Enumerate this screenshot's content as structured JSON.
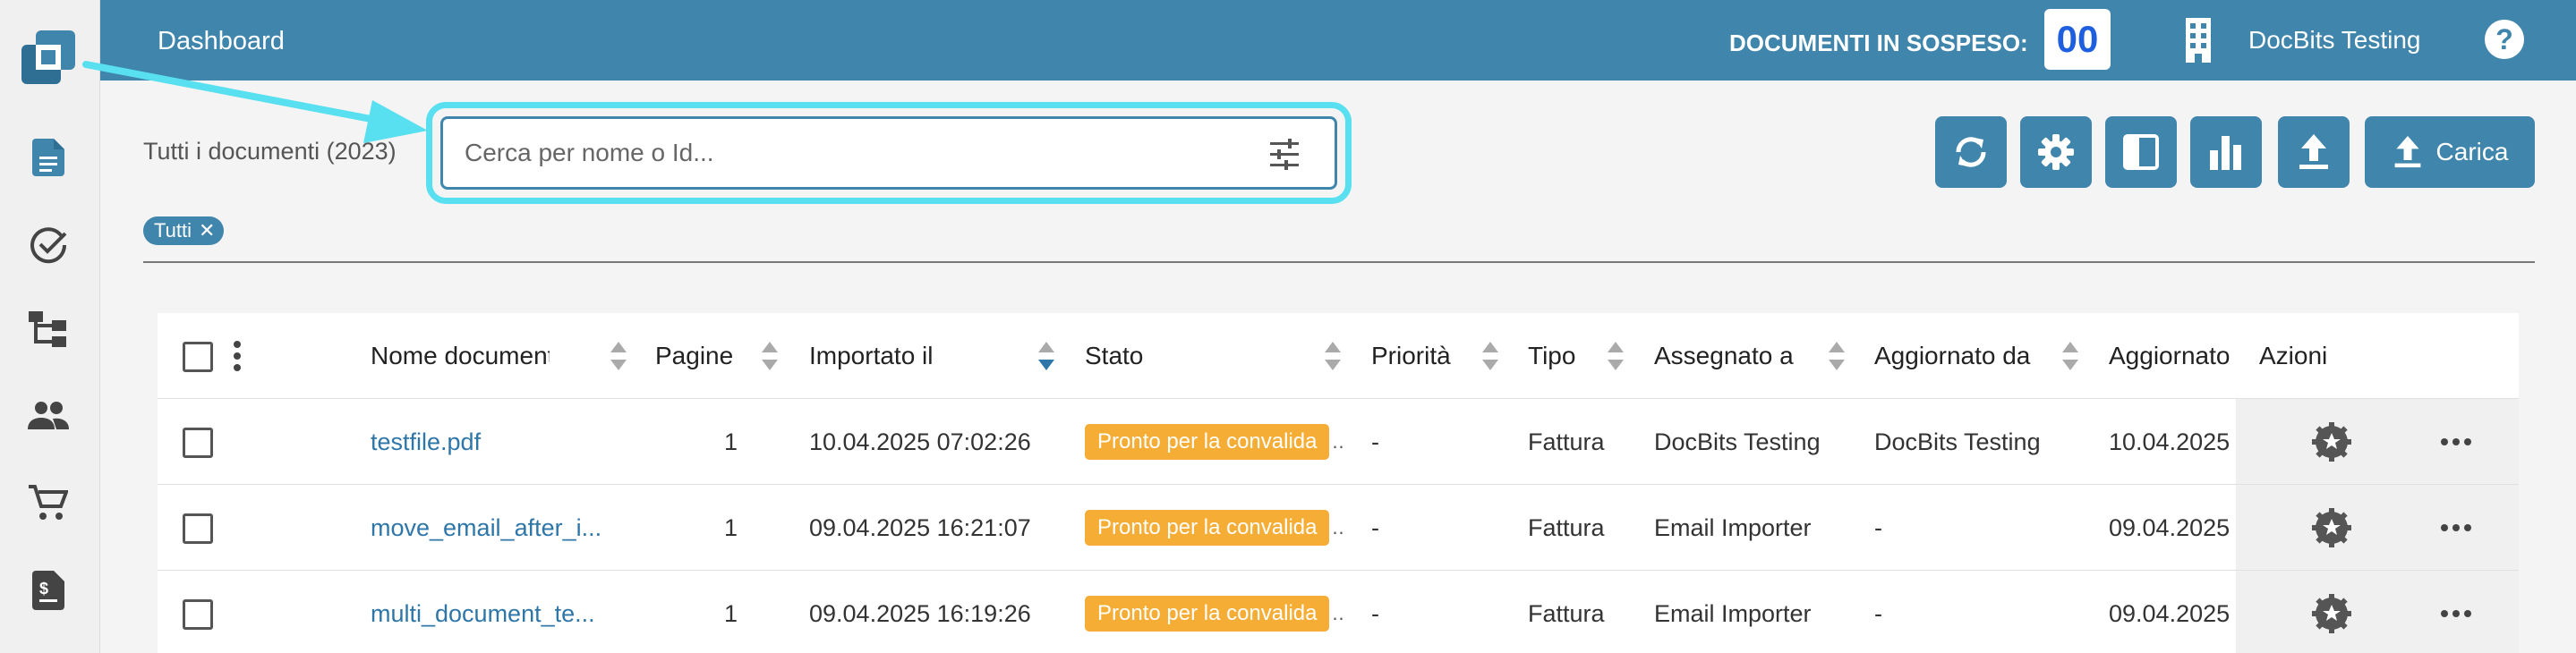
{
  "topbar": {
    "title": "Dashboard",
    "pending_label": "DOCUMENTI IN SOSPESO:",
    "pending_count": "00",
    "org_name": "DocBits Testing",
    "help": "?"
  },
  "sidebar": {
    "items": [
      {
        "icon": "document-icon"
      },
      {
        "icon": "check-circle-icon"
      },
      {
        "icon": "hierarchy-icon"
      },
      {
        "icon": "people-icon"
      },
      {
        "icon": "cart-icon"
      },
      {
        "icon": "invoice-icon"
      }
    ]
  },
  "filter": {
    "doc_count_label": "Tutti i documenti (2023)",
    "search_placeholder": "Cerca per nome o Id...",
    "search_value": "",
    "chip_label": "Tutti",
    "upload_label": "Carica"
  },
  "toolbar": {
    "buttons": [
      "refresh-icon",
      "settings-icon",
      "split-view-icon",
      "bar-chart-icon",
      "upload-icon"
    ]
  },
  "table": {
    "columns": [
      "Nome documento",
      "Pagine",
      "Importato il",
      "Stato",
      "Priorità",
      "Tipo",
      "Assegnato a",
      "Aggiornato da",
      "Aggiornato",
      "Azioni"
    ],
    "rows": [
      {
        "name": "testfile.pdf",
        "pages": "1",
        "imported": "10.04.2025 07:02:26",
        "status": "Pronto per la convalida",
        "priority": "-",
        "type": "Fattura",
        "assigned": "DocBits Testing",
        "updated_by": "DocBits Testing",
        "updated": "10.04.2025"
      },
      {
        "name": "move_email_after_i...",
        "pages": "1",
        "imported": "09.04.2025 16:21:07",
        "status": "Pronto per la convalida",
        "priority": "-",
        "type": "Fattura",
        "assigned": "Email Importer",
        "updated_by": "-",
        "updated": "09.04.2025"
      },
      {
        "name": "multi_document_te...",
        "pages": "1",
        "imported": "09.04.2025 16:19:26",
        "status": "Pronto per la convalida",
        "priority": "-",
        "type": "Fattura",
        "assigned": "Email Importer",
        "updated_by": "-",
        "updated": "09.04.2025"
      }
    ]
  },
  "colors": {
    "primary": "#4086ac",
    "status_ready": "#f5ad35",
    "highlight": "#58e0f0",
    "link": "#2e76a8"
  }
}
